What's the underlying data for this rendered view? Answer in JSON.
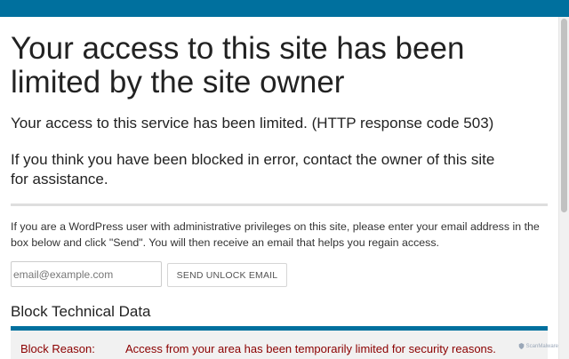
{
  "page": {
    "heading": "Your access to this site has been limited by the site owner",
    "lead_status": "Your access to this service has been limited. (HTTP response code 503)",
    "lead_contact": "If you think you have been blocked in error, contact the owner of this site for assistance.",
    "admin_info": "If you are a WordPress user with administrative privileges on this site, please enter your email address in the box below and click \"Send\". You will then receive an email that helps you regain access."
  },
  "unlock_form": {
    "email_placeholder": "email@example.com",
    "email_value": "",
    "send_label": "SEND UNLOCK EMAIL"
  },
  "technical": {
    "title": "Block Technical Data",
    "rows": [
      {
        "label": "Block Reason:",
        "value": "Access from your area has been temporarily limited for security reasons."
      }
    ]
  },
  "watermark": {
    "text": "ScanMalware"
  },
  "colors": {
    "accent": "#00709e",
    "reason_text": "#8b0000",
    "row_bg": "#f1f1f1"
  }
}
